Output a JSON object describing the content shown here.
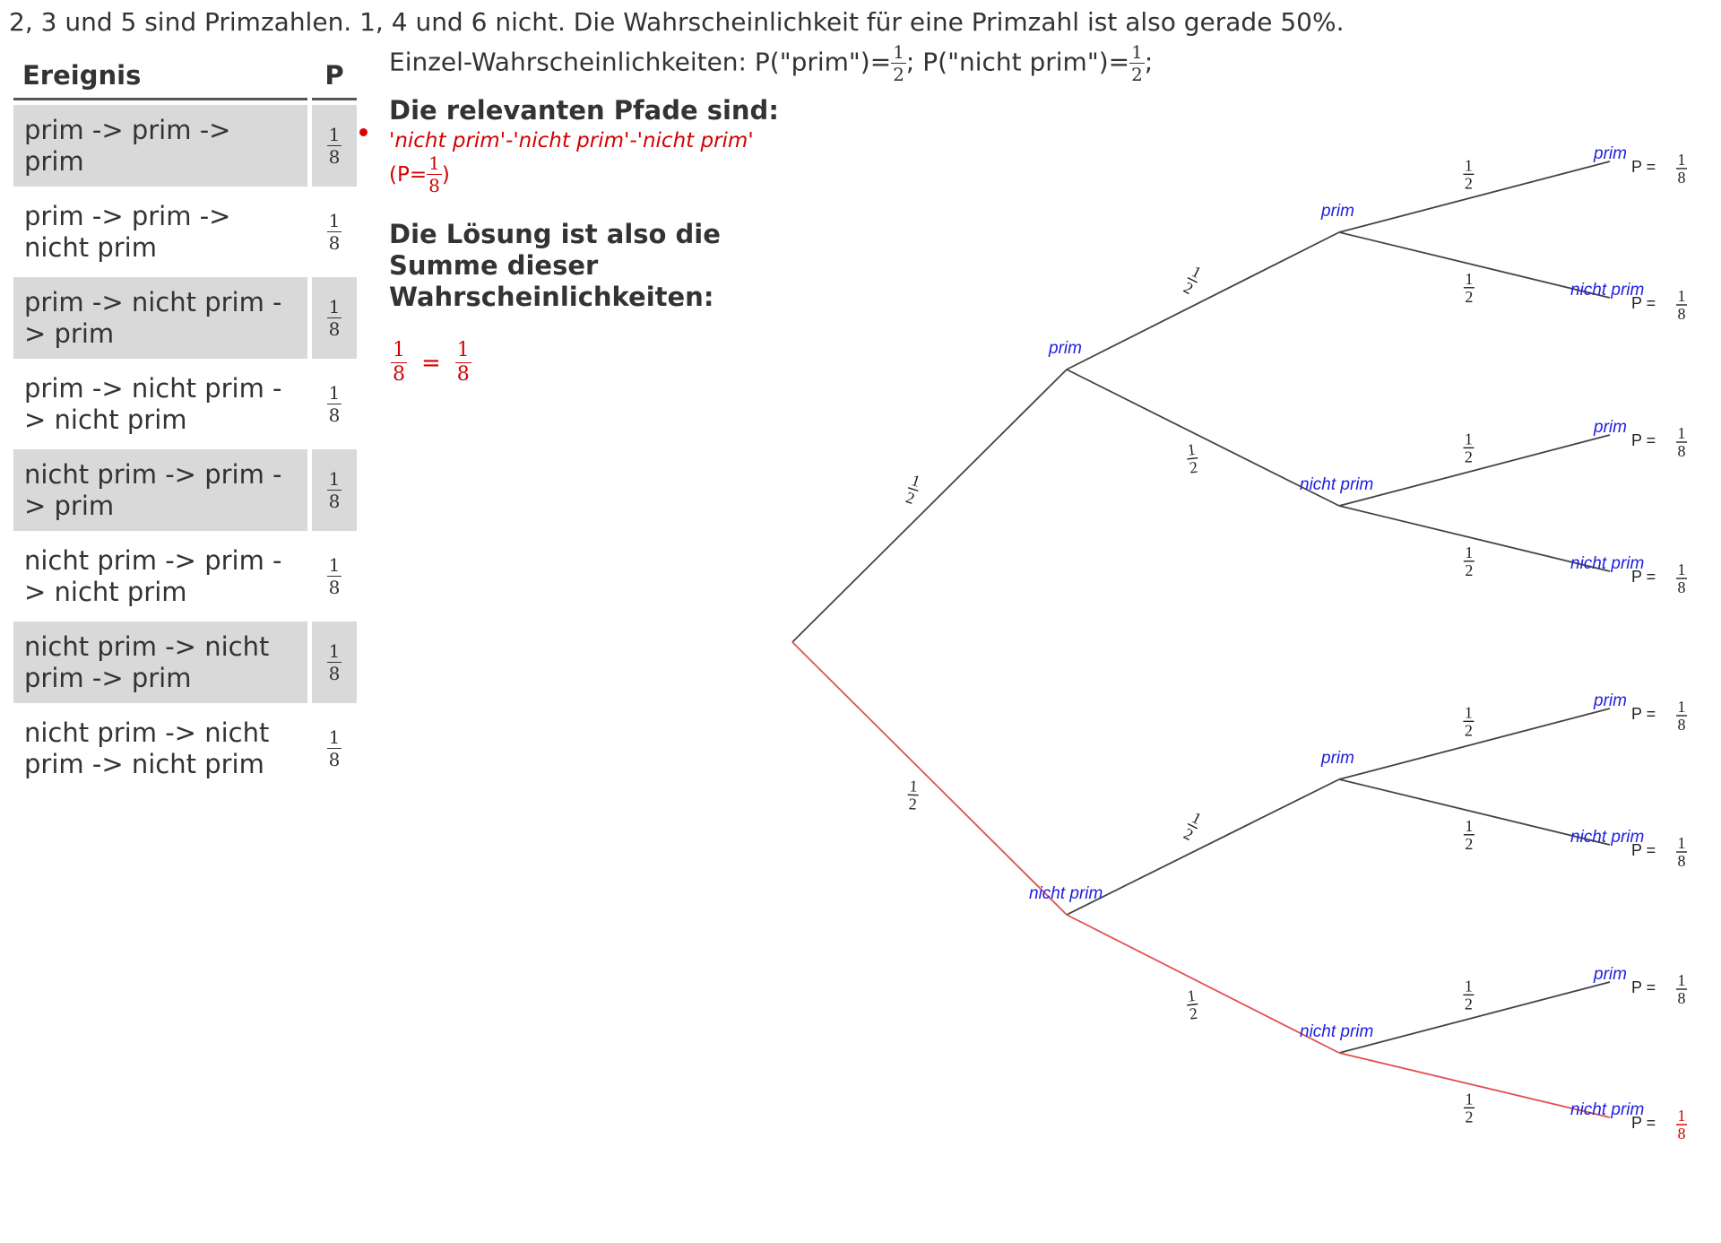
{
  "intro": "2, 3 und 5 sind Primzahlen. 1, 4 und 6 nicht. Die Wahrscheinlichkeit für eine Primzahl ist also gerade 50%.",
  "einzel": {
    "prefix": "Einzel-Wahrscheinlichkeiten: P(\"prim\")=",
    "mid": "; P(\"nicht prim\")=",
    "suffix": ";",
    "p_prim": {
      "num": "1",
      "den": "2"
    },
    "p_nicht": {
      "num": "1",
      "den": "2"
    }
  },
  "table": {
    "header": {
      "event": "Ereignis",
      "p": "P"
    },
    "rows": [
      {
        "event": "prim -> prim -> prim",
        "num": "1",
        "den": "8"
      },
      {
        "event": "prim -> prim -> nicht prim",
        "num": "1",
        "den": "8"
      },
      {
        "event": "prim -> nicht prim -> prim",
        "num": "1",
        "den": "8"
      },
      {
        "event": "prim -> nicht prim -> nicht prim",
        "num": "1",
        "den": "8"
      },
      {
        "event": "nicht prim -> prim -> prim",
        "num": "1",
        "den": "8"
      },
      {
        "event": "nicht prim -> prim -> nicht prim",
        "num": "1",
        "den": "8"
      },
      {
        "event": "nicht prim -> nicht prim -> prim",
        "num": "1",
        "den": "8"
      },
      {
        "event": "nicht prim -> nicht prim -> nicht prim",
        "num": "1",
        "den": "8"
      }
    ]
  },
  "relevant": {
    "title": "Die relevanten Pfade sind:",
    "path": "'nicht prim'-'nicht prim'-'nicht prim'",
    "p_open": "(P=",
    "p_num": "1",
    "p_den": "8",
    "p_close": ")"
  },
  "solution": {
    "title": "Die Lösung ist also die Summe dieser Wahrscheinlichkeiten:",
    "lhs_num": "1",
    "lhs_den": "8",
    "eq": "=",
    "rhs_num": "1",
    "rhs_den": "8"
  },
  "tree": {
    "labels": {
      "prim": "prim",
      "nicht": "nicht prim",
      "p": "P ="
    },
    "branch_prob": {
      "num": "1",
      "den": "2"
    },
    "leaf_prob": {
      "num": "1",
      "den": "8"
    },
    "colors": {
      "line": "#444444",
      "highlight": "#e05050",
      "node_label": "#1f1fe0",
      "leaf_highlight": "#d40000"
    },
    "highlighted_path": [
      "nicht prim",
      "nicht prim",
      "nicht prim"
    ]
  }
}
